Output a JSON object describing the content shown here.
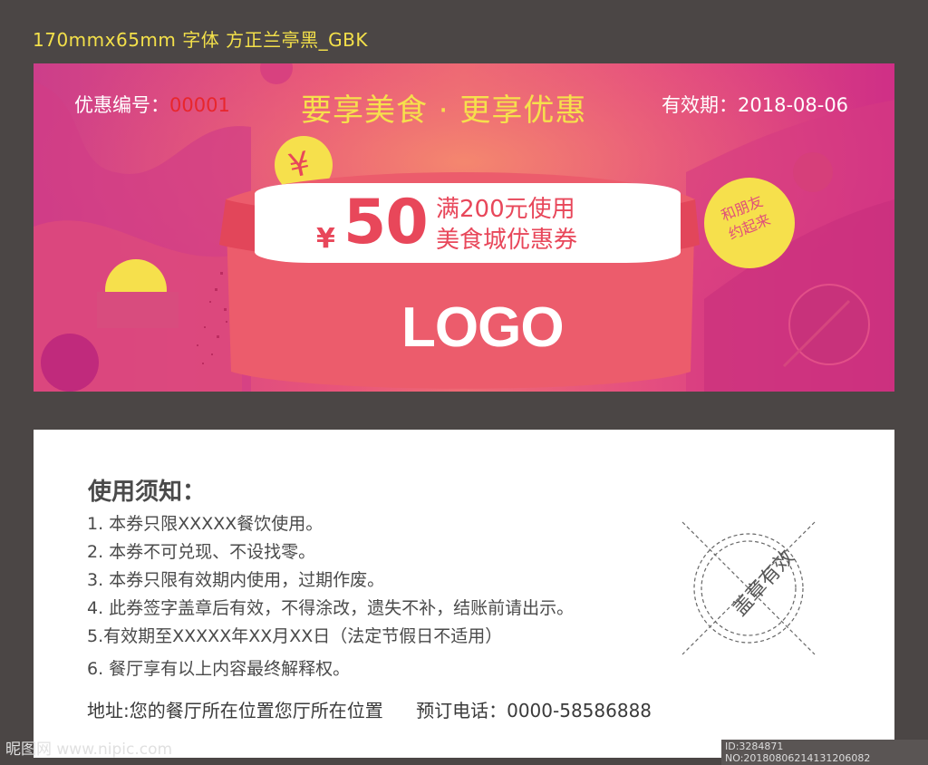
{
  "spec": "170mmx65mm  字体 方正兰亭黑_GBK",
  "front": {
    "coupon_label": "优惠编号：",
    "coupon_number": "00001",
    "headline": "要享美食 · 更享优惠",
    "expiry_label": "有效期：2018-08-06",
    "yen": "¥",
    "amount": "50",
    "condition_line1": "满200元使用",
    "condition_line2": "美食城优惠券",
    "logo": "LOGO",
    "badge_line1": "和朋友",
    "badge_line2": "约起来",
    "icon_yen": "¥",
    "icon_dollar": "$",
    "colors": {
      "accent_yellow": "#f6e04c",
      "pink": "#e5507f",
      "red": "#e8475a",
      "magenta": "#cf2f86"
    }
  },
  "back": {
    "title": "使用须知：",
    "rules": [
      "1. 本券只限XXXXX餐饮使用。",
      "2. 本券不可兑现、不设找零。",
      "3. 本券只限有效期内使用，过期作废。",
      "4. 此券签字盖章后有效，不得涂改，遗失不补，结账前请出示。",
      "5.有效期至XXXXX年XX月XX日（法定节假日不适用）",
      "6. 餐厅享有以上内容最终解释权。"
    ],
    "address": "地址:您的餐厅所在位置您厅所在位置",
    "phone": "预订电话：0000-58586888",
    "stamp_text": "盖章有效"
  },
  "watermark": {
    "left": "昵图网 www.nipic.com",
    "right": "ID:3284871 NO:20180806214131206082"
  }
}
